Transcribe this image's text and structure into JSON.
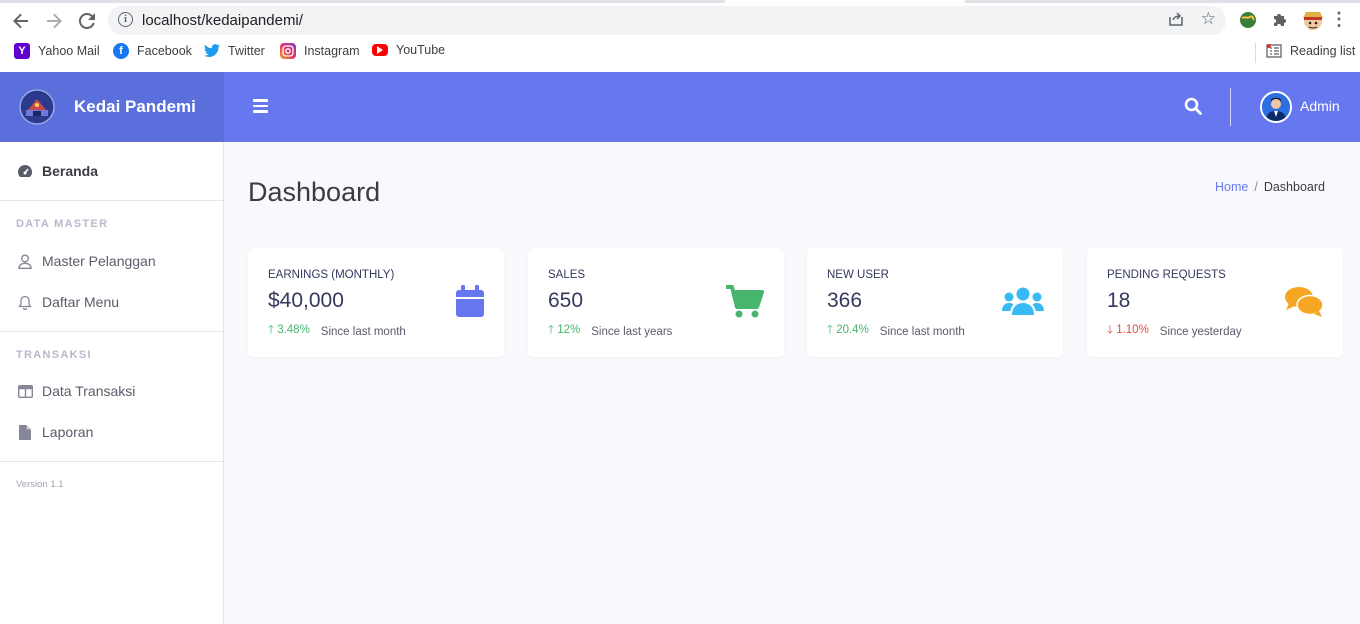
{
  "browser": {
    "url": "localhost/kedaipandemi/",
    "bookmarks": [
      {
        "label": "Yahoo Mail",
        "icon": "yahoo-icon",
        "color": "#5f01d1"
      },
      {
        "label": "Facebook",
        "icon": "facebook-icon",
        "color": "#1877f2"
      },
      {
        "label": "Twitter",
        "icon": "twitter-icon",
        "color": "#1d9bf0"
      },
      {
        "label": "Instagram",
        "icon": "instagram-icon",
        "color": "#e1306c"
      },
      {
        "label": "YouTube",
        "icon": "youtube-icon",
        "color": "#ff0000"
      }
    ],
    "reading_list": "Reading list"
  },
  "sidebar": {
    "brand": "Kedai Pandemi",
    "home": {
      "label": "Beranda",
      "icon": "gauge-icon"
    },
    "section_master": "DATA MASTER",
    "master_items": [
      {
        "label": "Master Pelanggan",
        "icon": "user-icon"
      },
      {
        "label": "Daftar Menu",
        "icon": "bell-icon"
      }
    ],
    "section_transaksi": "TRANSAKSI",
    "transaksi_items": [
      {
        "label": "Data Transaksi",
        "icon": "columns-icon"
      },
      {
        "label": "Laporan",
        "icon": "file-icon"
      }
    ],
    "version": "Version 1.1"
  },
  "topbar": {
    "user": "Admin",
    "colors": {
      "primary": "#6777ef",
      "brand": "#5a6fdc"
    }
  },
  "main": {
    "title": "Dashboard",
    "breadcrumb": {
      "home": "Home",
      "current": "Dashboard"
    },
    "cards": [
      {
        "label": "EARNINGS (MONTHLY)",
        "value": "$40,000",
        "change": "3.48%",
        "direction": "up",
        "since": "Since last month",
        "icon": "calendar-icon",
        "color": "#6777ef"
      },
      {
        "label": "SALES",
        "value": "650",
        "change": "12%",
        "direction": "up",
        "since": "Since last years",
        "icon": "cart-icon",
        "color": "#47b56b"
      },
      {
        "label": "NEW USER",
        "value": "366",
        "change": "20.4%",
        "direction": "up",
        "since": "Since last month",
        "icon": "users-icon",
        "color": "#3abaf4"
      },
      {
        "label": "PENDING REQUESTS",
        "value": "18",
        "change": "1.10%",
        "direction": "down",
        "since": "Since yesterday",
        "icon": "comments-icon",
        "color": "#f6a623"
      }
    ]
  }
}
